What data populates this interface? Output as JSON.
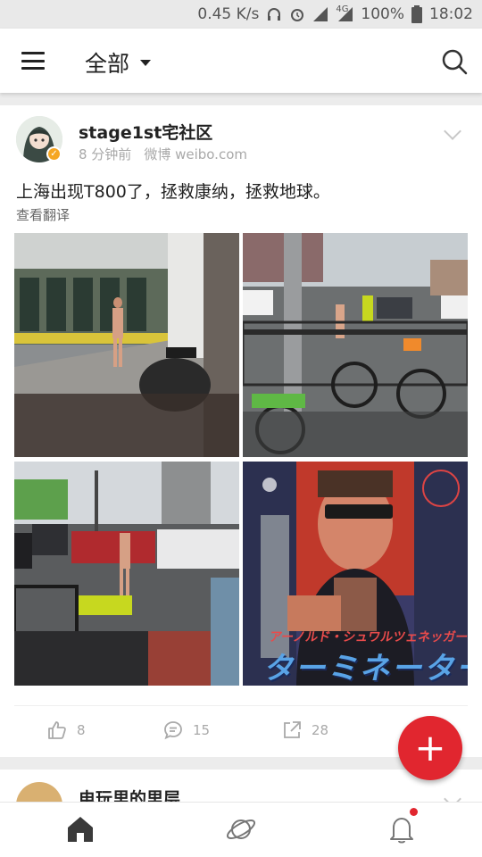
{
  "status_bar": {
    "speed": "0.45 K/s",
    "network": "4G",
    "battery": "100%",
    "time": "18:02"
  },
  "app_bar": {
    "title": "全部",
    "menu_icon": "menu-icon",
    "search_icon": "search-icon"
  },
  "posts": [
    {
      "author": "stage1st宅社区",
      "time_ago": "8 分钟前",
      "source": "微博 weibo.com",
      "content": "上海出现T800了，拯救康纳，拯救地球。",
      "translate_label": "查看翻译",
      "images": [
        "subway-platform-photo",
        "street-bicycles-photo",
        "traffic-street-photo",
        "terminator-poster"
      ],
      "poster_text": "アーノルド・シュワルツェネッガー",
      "poster_title": "ターミネーター",
      "likes": "8",
      "comments": "15",
      "shares": "28"
    },
    {
      "author": "电玩里的里层"
    }
  ],
  "fab_label": "+",
  "bottom_nav": [
    "home-icon",
    "planet-icon",
    "bell-icon"
  ],
  "colors": {
    "accent": "#e1262f",
    "meta_text": "#a9a9a9"
  }
}
